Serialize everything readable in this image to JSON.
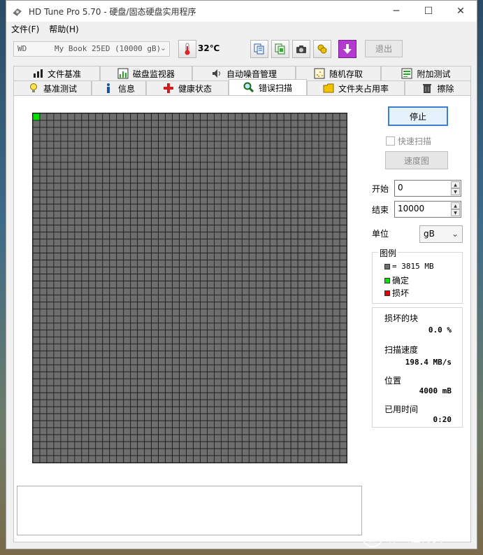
{
  "window": {
    "title": "HD Tune Pro 5.70 - 硬盘/固态硬盘实用程序",
    "minimize": "─",
    "maximize": "☐",
    "close": "✕"
  },
  "menu": [
    "文件(F)",
    "帮助(H)"
  ],
  "toolbar": {
    "drive": "WD      My Book 25ED (10000 gB)",
    "temperature": "32℃",
    "icons": [
      "copy-text-icon",
      "copy-screen-icon",
      "camera-icon",
      "save-icon",
      "download-icon"
    ],
    "exit_label": "退出"
  },
  "tabs": {
    "row1": [
      {
        "label": "文件基准",
        "icon": "file-benchmark-icon"
      },
      {
        "label": "磁盘监视器",
        "icon": "disk-monitor-icon"
      },
      {
        "label": "自动噪音管理",
        "icon": "speaker-icon"
      },
      {
        "label": "随机存取",
        "icon": "random-access-icon"
      },
      {
        "label": "附加测试",
        "icon": "extra-tests-icon"
      }
    ],
    "row2": [
      {
        "label": "基准测试",
        "icon": "benchmark-icon"
      },
      {
        "label": "信息",
        "icon": "info-icon"
      },
      {
        "label": "健康状态",
        "icon": "health-cross-icon"
      },
      {
        "label": "错误扫描",
        "icon": "magnifier-icon"
      },
      {
        "label": "文件夹占用率",
        "icon": "folder-icon"
      },
      {
        "label": "擦除",
        "icon": "trash-icon"
      }
    ],
    "active": "错误扫描"
  },
  "scan": {
    "grid_cols": 45,
    "grid_rows": 50,
    "ok_blocks": 1,
    "colors": {
      "block": "#6e6e6e",
      "ok": "#00e000",
      "damaged": "#e00000",
      "gridline": "#1a1a1a"
    }
  },
  "controls": {
    "stop_label": "停止",
    "quick_scan_label": "快速扫描",
    "quick_scan_checked": false,
    "speed_map_label": "速度图",
    "start_label": "开始",
    "start_value": "0",
    "end_label": "结束",
    "end_value": "10000",
    "unit_label": "单位",
    "unit_value": "gB"
  },
  "legend": {
    "title": "图例",
    "block_size": "= 3815 MB",
    "ok_label": "确定",
    "damaged_label": "损坏"
  },
  "stats": {
    "damaged_label": "损坏的块",
    "damaged_value": "0.0 %",
    "speed_label": "扫描速度",
    "speed_value": "198.4 MB/s",
    "position_label": "位置",
    "position_value": "4000 mB",
    "elapsed_label": "已用时间",
    "elapsed_value": "0:20"
  },
  "watermark": {
    "badge": "值",
    "text": "什么值得买"
  }
}
